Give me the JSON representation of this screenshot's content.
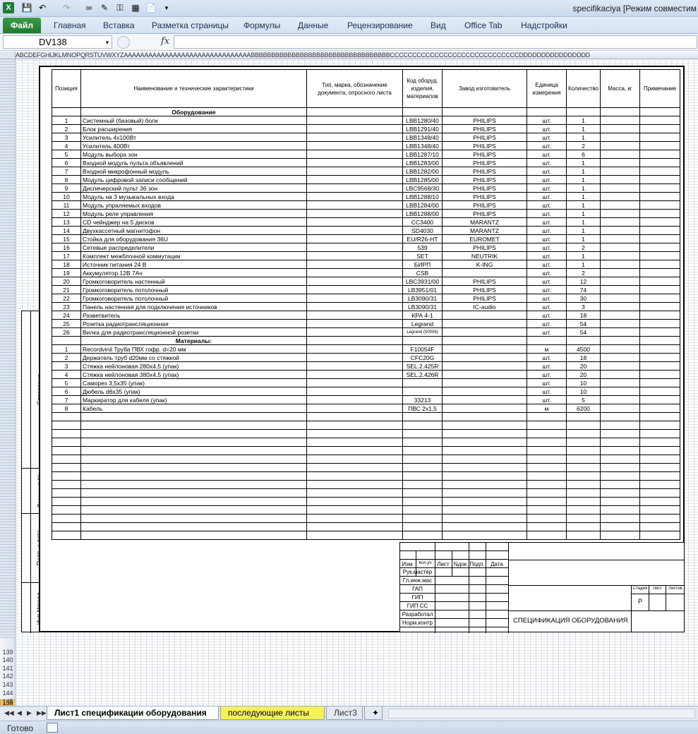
{
  "window": {
    "title": "specifikaciya  [Режим совместим"
  },
  "ribbon": {
    "file_tab": "Файл",
    "tabs": [
      "Главная",
      "Вставка",
      "Разметка страницы",
      "Формулы",
      "Данные",
      "Рецензирование",
      "Вид",
      "Office Tab",
      "Надстройки"
    ]
  },
  "formula_bar": {
    "name_box": "DV138",
    "fx_label": "fx",
    "formula": ""
  },
  "column_headers": "ABCDEFGHIJKLMNOPQRSTUVWXYZAAAAAAAAAAAAAAAAAAAAAAAAAAAAAAABBBBBBBBBBBBBBBBBBBBBBBBBBBBBBBBBBCCCCCCCCCCCCCCCCCCCCCCCCCCCCCDDDDDDDDDDDDDDDD",
  "row_headers": {
    "active": "138",
    "after": [
      "139",
      "140",
      "141",
      "142",
      "143",
      "144",
      "145"
    ]
  },
  "spec_table": {
    "headers": [
      "Позиция",
      "Наименование и технические характеристики",
      "Тип, марка, обозначение документа, опросного листа",
      "Код оборуд. изделия, материалов",
      "Завод изготовитель",
      "Единица измерения",
      "Количество",
      "Масса, кг",
      "Примечание"
    ],
    "section_equipment": "Оборудование",
    "equipment": [
      [
        "1",
        "Системный (базовый) болк",
        "LBB1280/40",
        "PHILIPS",
        "шт.",
        "1"
      ],
      [
        "2",
        "Блок расширения",
        "LBB1291/40",
        "PHILIPS",
        "шт.",
        "1"
      ],
      [
        "3",
        "Усилитель 4х100Вт",
        "LBB1348/40",
        "PHILIPS",
        "шт.",
        "1"
      ],
      [
        "4",
        "Усилитель 400Вт",
        "LBB1348/40",
        "PHILIPS",
        "шт.",
        "2"
      ],
      [
        "5",
        "Модуль выбора зон",
        "LBB1287/10",
        "PHILIPS",
        "шт.",
        "6"
      ],
      [
        "6",
        "Входной модуль пульта объявлений",
        "LBB1283/00",
        "PHILIPS",
        "шт.",
        "1"
      ],
      [
        "7",
        "Входной микрофонный модуль",
        "LBB1282/00",
        "PHILIPS",
        "шт.",
        "1"
      ],
      [
        "8",
        "Модуль цифровой записи сообщений",
        "LBB1285/00",
        "PHILIPS",
        "шт.",
        "1"
      ],
      [
        "9",
        "Диспечерский пульт 36 зон",
        "LBC9568/30",
        "PHILIPS",
        "шт.",
        "1"
      ],
      [
        "10",
        "Модуль на 3 музыкальных входа",
        "LBB1288/10",
        "PHILIPS",
        "шт.",
        "1"
      ],
      [
        "11",
        "Модуль упраляемых входов",
        "LBB1284/00",
        "PHILIPS",
        "шт.",
        "1"
      ],
      [
        "12",
        "Модуль реле управления",
        "LBB1288/00",
        "PHILIPS",
        "шт.",
        "1"
      ],
      [
        "13",
        "CD чейнджер на 5 дисков",
        "CC3400",
        "MARANTZ",
        "шт.",
        "1"
      ],
      [
        "14",
        "Двухкассетный магнитофон",
        "SD4030",
        "MARANTZ",
        "шт.",
        "1"
      ],
      [
        "15",
        "Стойка для оборудования 36U",
        "EU/R26-HT",
        "EUROMET",
        "шт.",
        "1"
      ],
      [
        "16",
        "Сетевые распределители",
        "539",
        "PHILIPS",
        "шт.",
        "2"
      ],
      [
        "17",
        "Комплект межблочной коммутации",
        "SET",
        "NEUTRIK",
        "шт.",
        "1"
      ],
      [
        "18",
        "Источник питания 24 В",
        "БИРП",
        "K-ING",
        "шт.",
        "1"
      ],
      [
        "19",
        "Аккумулятор 12В 7Ач",
        "CSB",
        "",
        "шт.",
        "2"
      ],
      [
        "20",
        "Громкоговоритель настенный",
        "LBC3931/00",
        "PHILIPS",
        "шт.",
        "12"
      ],
      [
        "21",
        "Громкоговоритель потолочный",
        "LB3951/01",
        "PHILIPS",
        "шт.",
        "74"
      ],
      [
        "22",
        "Громкоговоритель потолочный",
        "LB3090/31",
        "PHILIPS",
        "шт.",
        "30"
      ],
      [
        "23",
        "Панель настенная для подключения источников",
        "LB3090/31",
        "IC-audio",
        "шт.",
        "3"
      ],
      [
        "24",
        "Разветвитель",
        "КРА 4-1",
        "",
        "шт.",
        "18"
      ],
      [
        "25",
        "Розетка радиотрансляционная",
        "Legrand",
        "",
        "шт.",
        "54"
      ],
      [
        "26",
        "Вилка для радиотрансляционной розетки",
        "Legrand (50006)",
        "",
        "шт.",
        "54"
      ]
    ],
    "section_materials": "Материалы:",
    "materials": [
      [
        "1",
        "Recordvinil Труба ПВХ гофр. d=20 мм",
        "F10054F",
        "",
        "м",
        "4500"
      ],
      [
        "2",
        "Держатель труб d20мм  со стяжкой",
        "CFC20G",
        "",
        "шт.",
        "18"
      ],
      [
        "3",
        "Стяжка нейлоновая 280х4,5 (упак)",
        "SEL.2.425R",
        "",
        "шт.",
        "20"
      ],
      [
        "4",
        "Стяжка нейлоновая 380х4,5 (упак)",
        "SEL.2.426R",
        "",
        "шт.",
        "20"
      ],
      [
        "5",
        "Саморез 3,5х35 (упак)",
        "",
        "",
        "шт.",
        "10"
      ],
      [
        "6",
        "Дюбель d6х35 (упак)",
        "",
        "",
        "шт.",
        "10"
      ],
      [
        "7",
        "Маркиратор для кабеля (упак)",
        "33213",
        "",
        "шт.",
        "5"
      ],
      [
        "8",
        "Кабель",
        "ПВС 2х1,5",
        "",
        "м",
        "6200"
      ]
    ]
  },
  "side_stamp": {
    "agreed": "Спасовано",
    "interchange": "Взам.инв.№",
    "signature_date": "Подп. и дата",
    "inventory": "Инв.№подл."
  },
  "title_block": {
    "cols": [
      "Изм.",
      "Кол.уч",
      "Лист",
      "Nдок",
      "Подп.",
      "Дата"
    ],
    "roles": [
      "Рук.мастер",
      "Гл.инж.мас",
      "ГАП",
      "ГИП",
      "ГИП СС",
      "Разработал",
      "Норм.контр"
    ],
    "stage_labels": [
      "Стадия",
      "Лист",
      "Листов"
    ],
    "stage": "Р",
    "doc_title": "СПЕЦИФИКАЦИЯ ОБОРУДОВАНИЯ"
  },
  "sheet_tabs": {
    "tabs": [
      "Лист1 спецификации оборудования",
      "последующие листы",
      "Лист3"
    ],
    "active": "Лист1 спецификации оборудования"
  },
  "status": {
    "text": "Готово"
  }
}
